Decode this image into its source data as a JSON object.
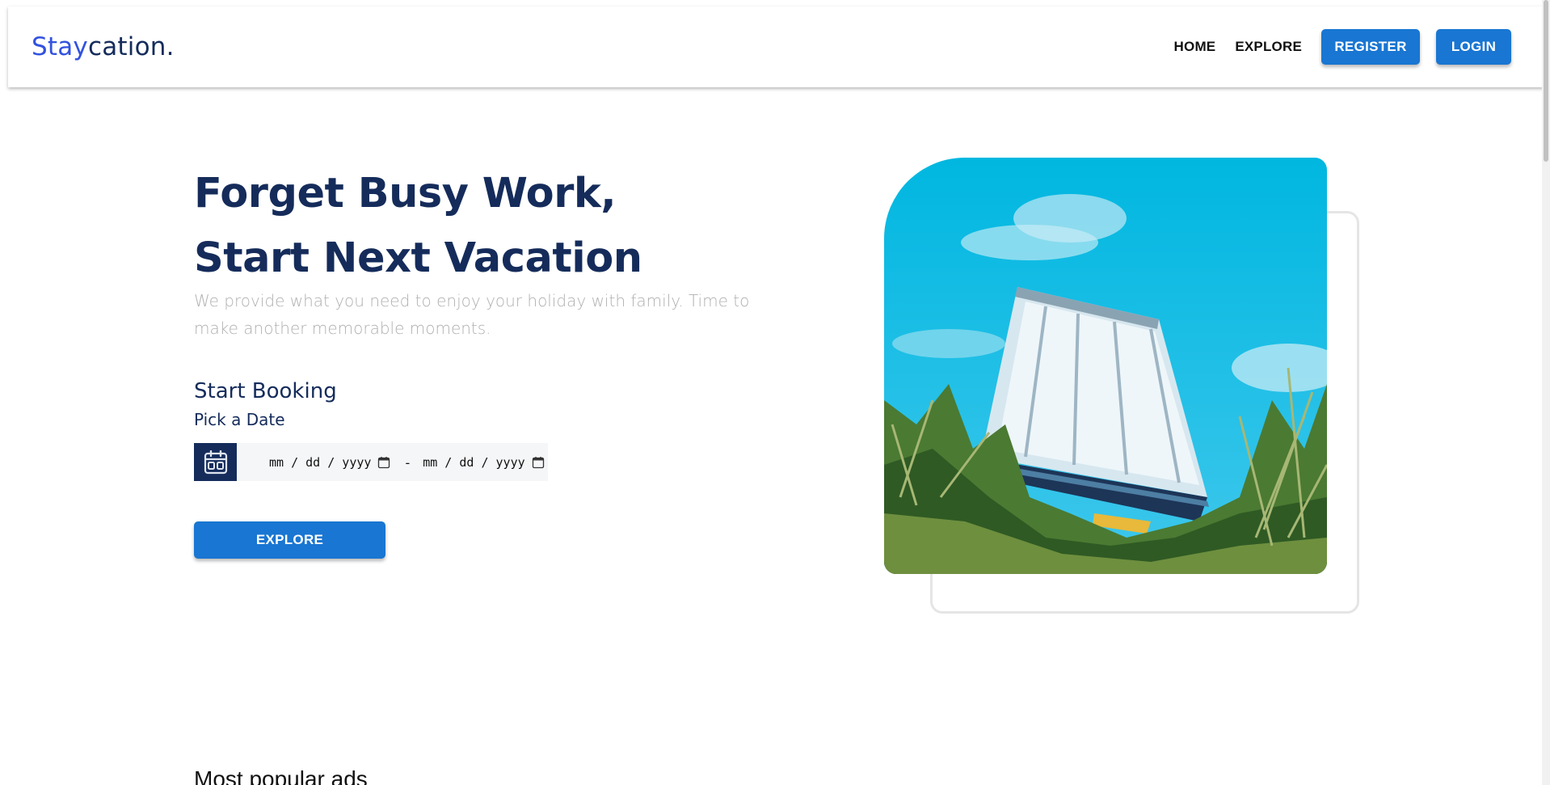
{
  "brand": {
    "part1": "Stay",
    "part2": "cation."
  },
  "nav": {
    "home": "HOME",
    "explore": "EXPLORE",
    "register": "REGISTER",
    "login": "LOGIN"
  },
  "hero": {
    "title_line1": "Forget Busy Work,",
    "title_line2": "Start Next Vacation",
    "subtitle": "We provide what you need to enjoy your holiday with family. Time to make another memorable moments."
  },
  "booking": {
    "title": "Start Booking",
    "pick_label": "Pick a Date",
    "date_from_placeholder": "mm / dd / yyyy",
    "separator": "-",
    "date_to_placeholder": "mm / dd / yyyy",
    "calendar_icon": "calendar-icon",
    "explore_label": "EXPLORE"
  },
  "sections": {
    "popular_title": "Most popular ads"
  },
  "colors": {
    "brand_blue": "#3252df",
    "navy": "#152c5b",
    "button_blue": "#1976d2",
    "subtitle_gray": "#b0b0b0"
  }
}
